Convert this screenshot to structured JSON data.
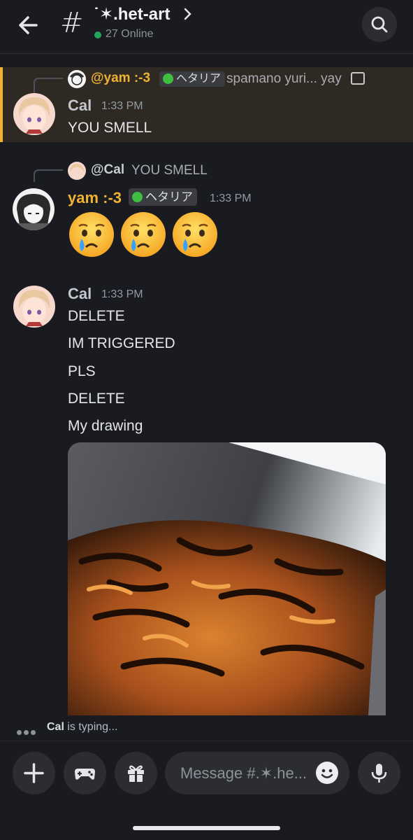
{
  "header": {
    "channel_name": "˙✶.het-art",
    "online": "27 Online"
  },
  "messages": [
    {
      "reply": {
        "name": "@yam :-3",
        "tag": "ヘタリア",
        "preview": "spamano yuri... yay"
      },
      "author": "Cal",
      "time": "1:33 PM",
      "lines": [
        "YOU SMELL"
      ]
    },
    {
      "reply": {
        "name": "@Cal",
        "preview": "YOU SMELL"
      },
      "author": "yam :-3",
      "tag": "ヘタリア",
      "time": "1:33 PM",
      "emoji": [
        "😢",
        "😢",
        "😢"
      ]
    },
    {
      "author": "Cal",
      "time": "1:33 PM",
      "lines": [
        "DELETE",
        "IM TRIGGERED",
        "PLS",
        "DELETE",
        "My drawing"
      ]
    }
  ],
  "typing": {
    "name": "Cal",
    "text": " is typing..."
  },
  "composer": {
    "placeholder": "Message #.✶.he..."
  },
  "icons": [
    "back-arrow-icon",
    "hash-icon",
    "chevron-right-icon",
    "search-icon",
    "image-icon",
    "plus-icon",
    "gamepad-icon",
    "gift-icon",
    "smile-icon",
    "microphone-icon"
  ],
  "colors": {
    "accent_gold": "#f0b232",
    "online_green": "#23a55a",
    "background": "#1a1b20"
  }
}
